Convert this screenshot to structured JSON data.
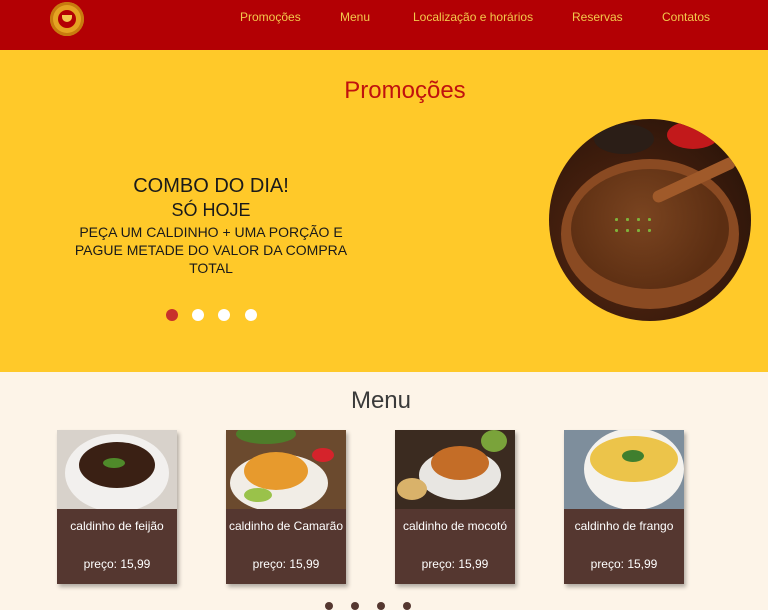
{
  "header": {
    "logo_icon": "restaurant-logo-icon",
    "nav": [
      "Promoções",
      "Menu",
      "Localização e horários",
      "Reservas",
      "Contatos"
    ]
  },
  "promo": {
    "title": "Promoções",
    "combo_title": "COMBO DO DIA!",
    "combo_subtitle": "SÓ HOJE",
    "combo_text": "PEÇA UM CALDINHO + UMA PORÇÃO E PAGUE METADE DO VALOR DA COMPRA TOTAL",
    "carousel_active_index": 0,
    "carousel_count": 4
  },
  "menu": {
    "title": "Menu",
    "items": [
      {
        "name": "caldinho de feijão",
        "price": "preço: 15,99"
      },
      {
        "name": "caldinho de Camarão",
        "price": "preço: 15,99"
      },
      {
        "name": "caldinho de mocotó",
        "price": "preço: 15,99"
      },
      {
        "name": "caldinho de frango",
        "price": "preço: 15,99"
      }
    ]
  },
  "colors": {
    "header_bg": "#b30004",
    "nav_text": "#f2c94c",
    "promo_bg": "#ffc929",
    "promo_title": "#c0120e",
    "card_bg": "#553730",
    "page_bg": "#fdf4e8",
    "dot_active": "#c8312b"
  }
}
